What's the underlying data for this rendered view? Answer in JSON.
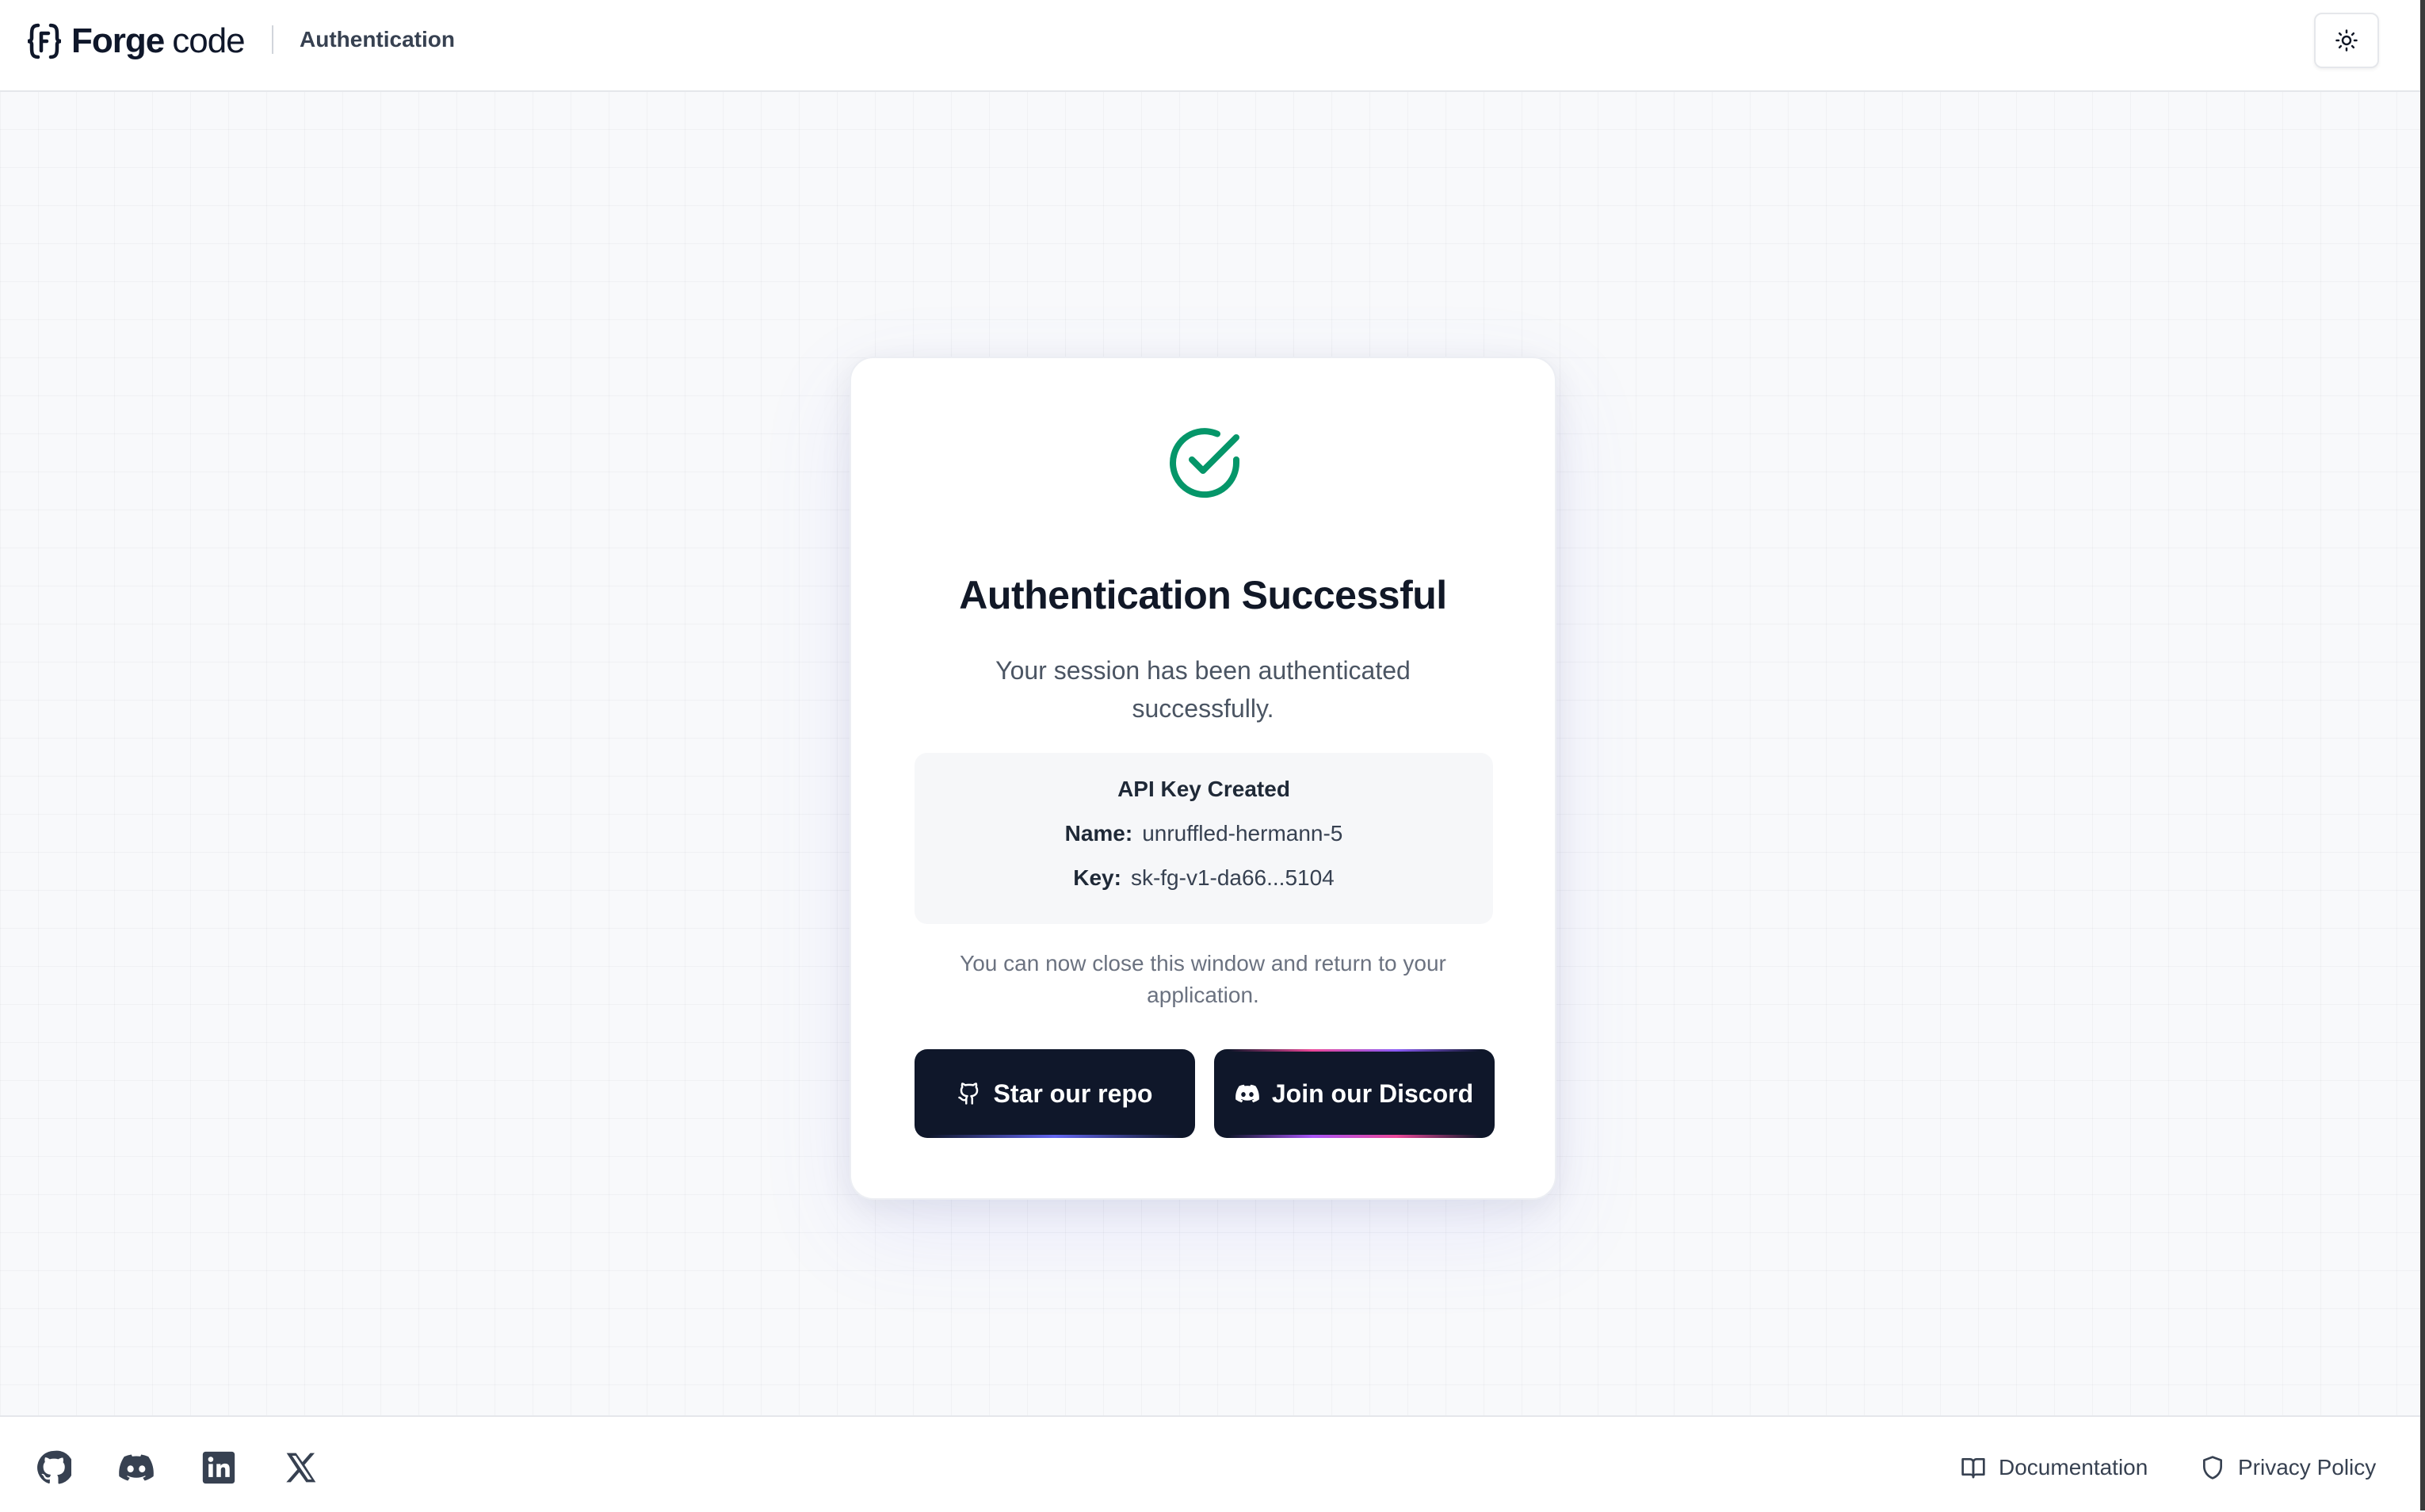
{
  "header": {
    "logo_forge": "Forge",
    "logo_code": "code",
    "title": "Authentication",
    "theme_toggle_icon": "sun-icon"
  },
  "card": {
    "status_icon": "check-circle-icon",
    "title": "Authentication Successful",
    "subtitle": "Your session has been authenticated successfully.",
    "api_key": {
      "heading": "API Key Created",
      "name_label": "Name:",
      "name_value": "unruffled-hermann-5",
      "key_label": "Key:",
      "key_value": "sk-fg-v1-da66...5104"
    },
    "note": "You can now close this window and return to your application.",
    "buttons": {
      "star_label": "Star our repo",
      "discord_label": "Join our Discord"
    }
  },
  "footer": {
    "social_icons": [
      "github-icon",
      "discord-icon",
      "linkedin-icon",
      "x-icon"
    ],
    "docs_label": "Documentation",
    "privacy_label": "Privacy Policy"
  },
  "colors": {
    "success": "#059669",
    "button_bg": "#0f172a",
    "accent_indigo": "#6366f1",
    "accent_pink": "#ec4899"
  }
}
